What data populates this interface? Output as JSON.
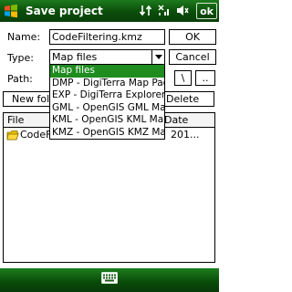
{
  "titlebar": {
    "title": "Save project",
    "ok_label": "ok",
    "icons": [
      "windows-start-icon",
      "connectivity-icon",
      "signal-icon",
      "volume-icon"
    ]
  },
  "form": {
    "name_label": "Name:",
    "name_value": "CodeFiltering.kmz",
    "type_label": "Type:",
    "type_value": "Map files",
    "path_label": "Path:",
    "ok_button": "OK",
    "cancel_button": "Cancel",
    "root_button": "\\",
    "up_button": "..",
    "new_folder_button": "New fold",
    "delete_button": "Delete"
  },
  "type_options": [
    {
      "label": "Map files",
      "selected": true
    },
    {
      "label": "DMP - DigiTerra Map Pack",
      "selected": false
    },
    {
      "label": "EXP - DigiTerra Explorer M",
      "selected": false
    },
    {
      "label": "GML - OpenGIS GML Map F",
      "selected": false
    },
    {
      "label": "KML - OpenGIS KML Map F",
      "selected": false
    },
    {
      "label": "KMZ - OpenGIS KMZ Map",
      "selected": false
    }
  ],
  "file_list": {
    "columns": [
      "File",
      "Date"
    ],
    "rows": [
      {
        "name": "CodeFiltering",
        "date": "201..."
      }
    ]
  },
  "colors": {
    "titlebar": "#0b4d0b",
    "selection": "#1e8c1e",
    "folder": "#e8c000"
  }
}
